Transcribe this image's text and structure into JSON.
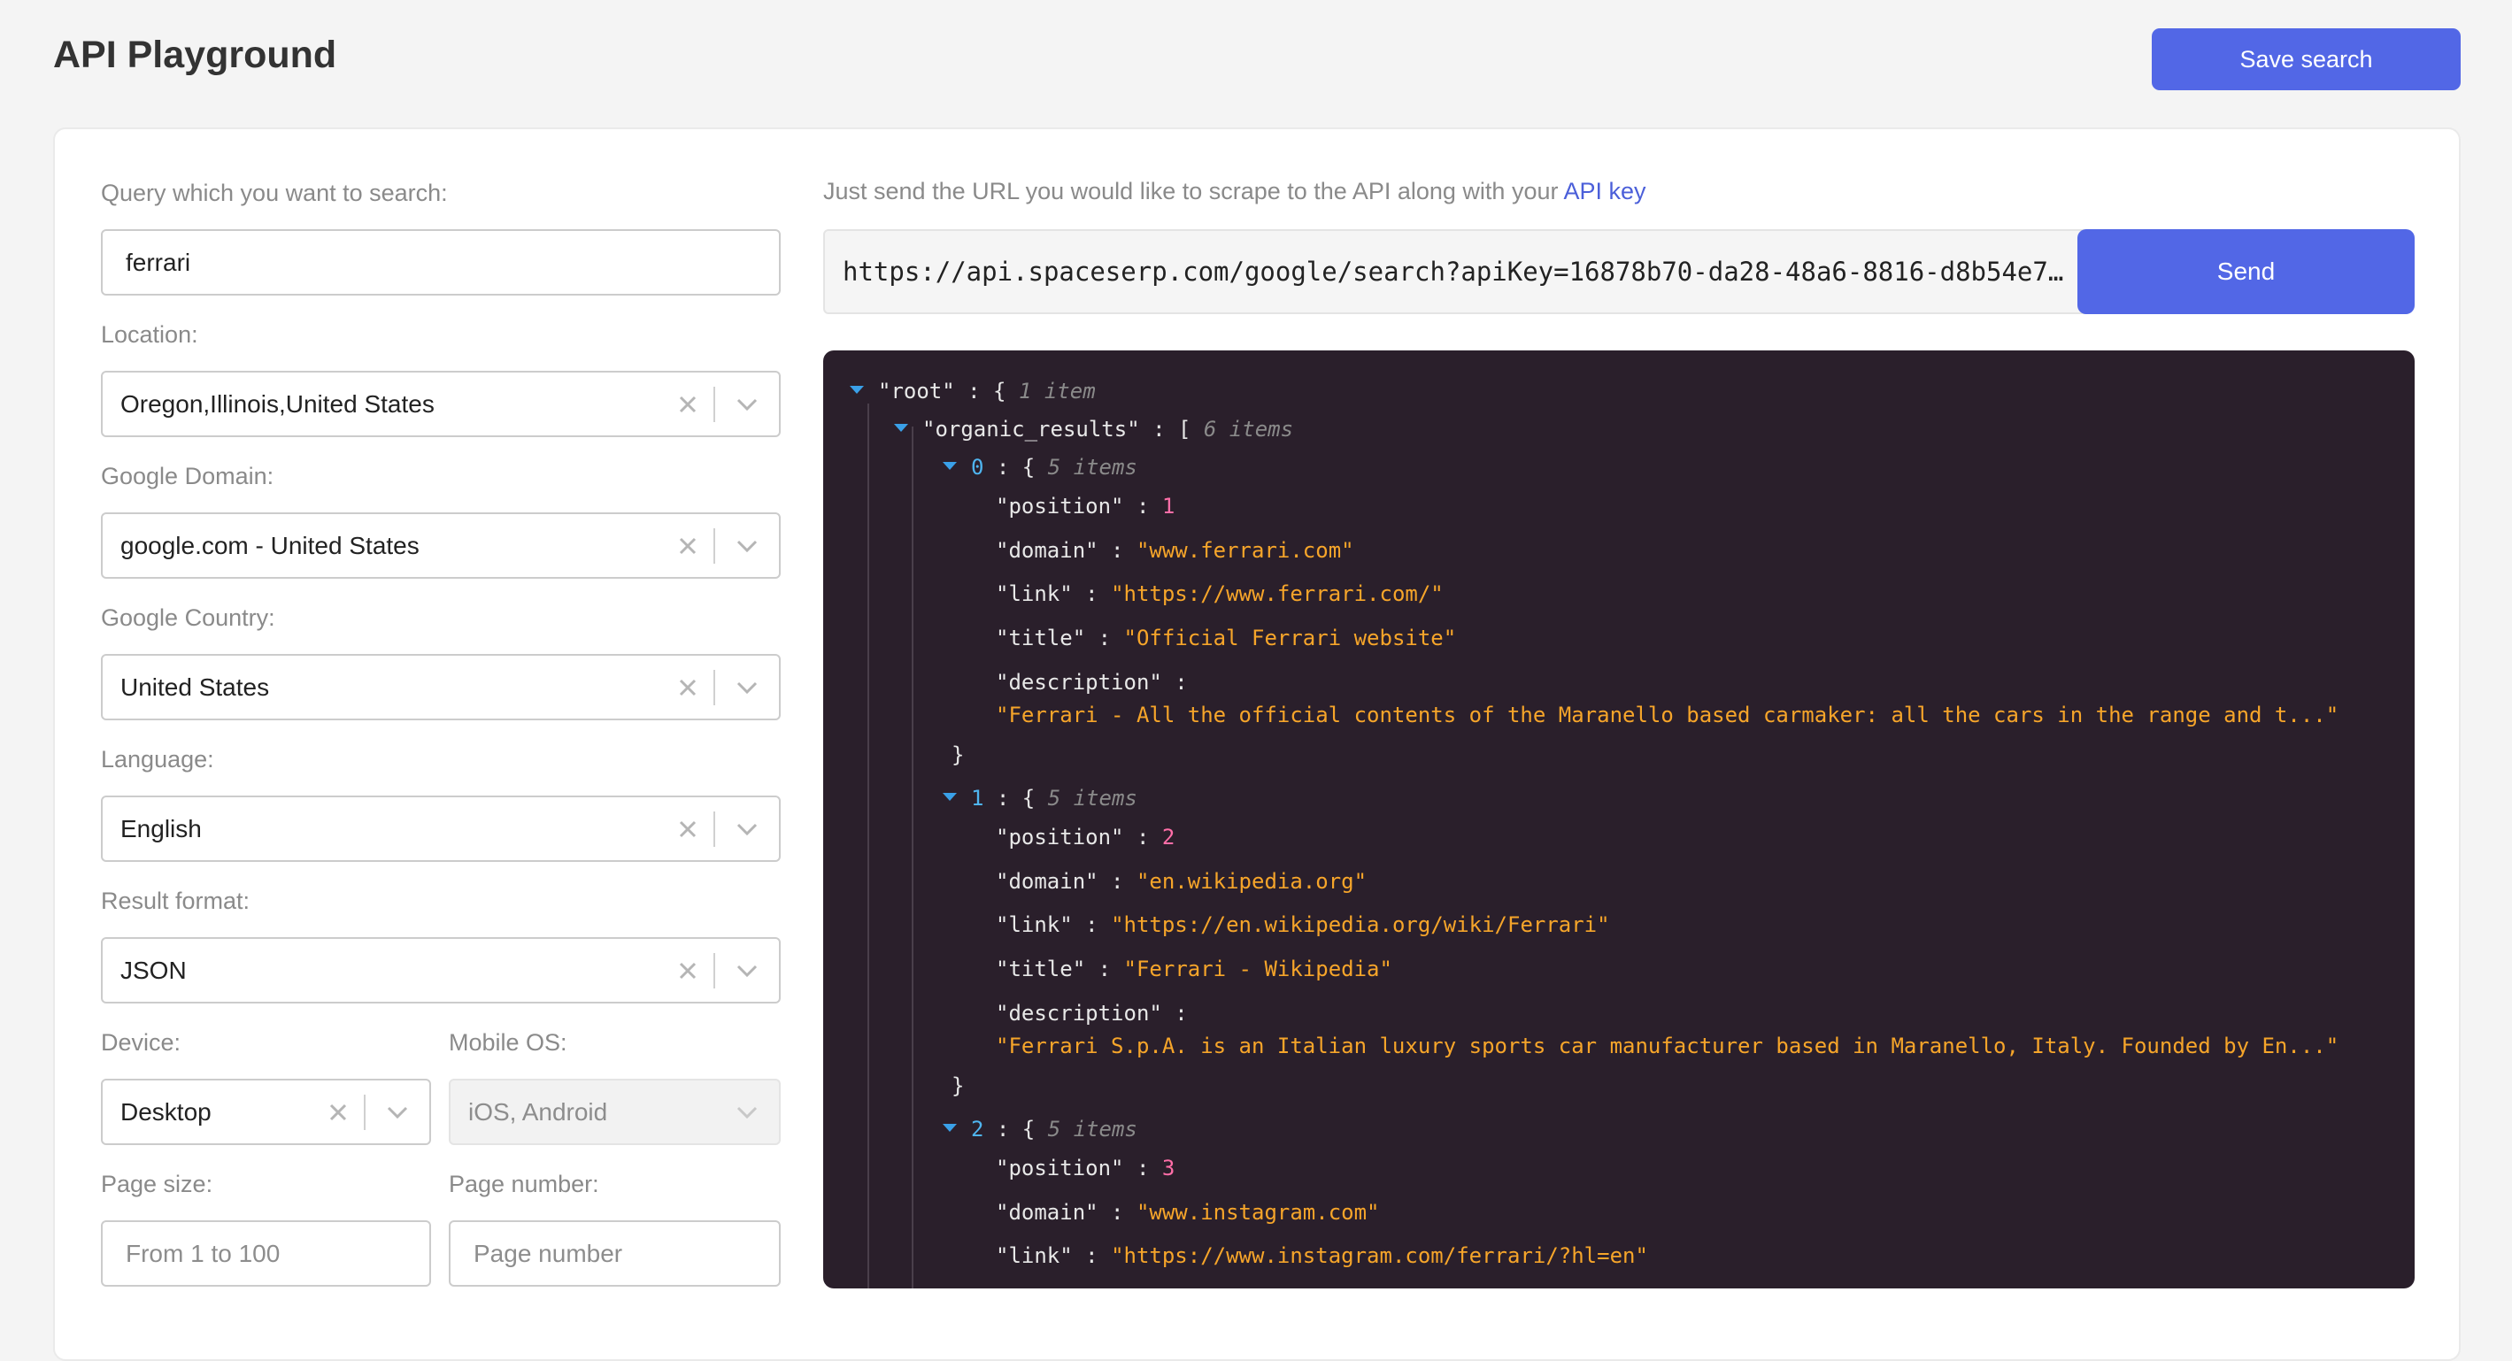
{
  "header": {
    "title": "API Playground",
    "save_label": "Save search"
  },
  "form": {
    "query_label": "Query which you want to search:",
    "query_value": "ferrari",
    "location_label": "Location:",
    "location_value": "Oregon,Illinois,United States",
    "domain_label": "Google Domain:",
    "domain_value": "google.com - United States",
    "country_label": "Google Country:",
    "country_value": "United States",
    "language_label": "Language:",
    "language_value": "English",
    "format_label": "Result format:",
    "format_value": "JSON",
    "device_label": "Device:",
    "device_value": "Desktop",
    "mobile_os_label": "Mobile OS:",
    "mobile_os_placeholder": "iOS, Android",
    "page_size_label": "Page size:",
    "page_size_placeholder": "From 1 to 100",
    "page_number_label": "Page number:",
    "page_number_placeholder": "Page number"
  },
  "api": {
    "hint_text": "Just send the URL you would like to scrape to the API along with your",
    "hint_link": "API key",
    "url": "https://api.spaceserp.com/google/search?apiKey=16878b70-da28-48a6-8816-d8b54e7…",
    "send_label": "Send"
  },
  "json": {
    "root_key": "\"root\"",
    "root_meta": "1 item",
    "organic_key": "\"organic_results\"",
    "organic_meta": "6 items",
    "results": [
      {
        "index": "0",
        "meta": "5 items",
        "position": "1",
        "domain": "\"www.ferrari.com\"",
        "link": "\"https://www.ferrari.com/\"",
        "title": "\"Official Ferrari website\"",
        "description": "\"Ferrari - All the official contents of the Maranello based carmaker: all the cars in the range and t...\""
      },
      {
        "index": "1",
        "meta": "5 items",
        "position": "2",
        "domain": "\"en.wikipedia.org\"",
        "link": "\"https://en.wikipedia.org/wiki/Ferrari\"",
        "title": "\"Ferrari - Wikipedia\"",
        "description": "\"Ferrari S.p.A. is an Italian luxury sports car manufacturer based in Maranello, Italy. Founded by En...\""
      },
      {
        "index": "2",
        "meta": "5 items",
        "position": "3",
        "domain": "\"www.instagram.com\"",
        "link": "\"https://www.instagram.com/ferrari/?hl=en\""
      }
    ],
    "keys": {
      "position": "\"position\"",
      "domain": "\"domain\"",
      "link": "\"link\"",
      "title": "\"title\"",
      "description": "\"description\""
    }
  },
  "colors": {
    "accent": "#5267e6",
    "json_bg": "#2a1f2b",
    "json_string": "#f6a52a",
    "json_number": "#ff6ea8"
  }
}
